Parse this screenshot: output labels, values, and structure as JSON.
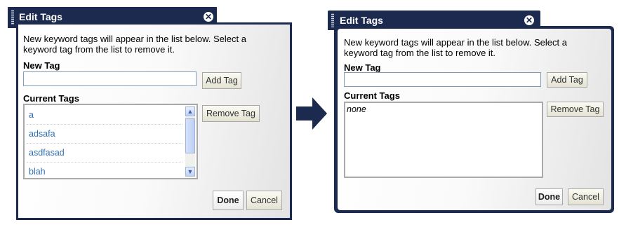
{
  "arrow_icon": "right-arrow-icon",
  "before": {
    "title": "Edit Tags",
    "close_icon": "close-icon",
    "description": "New keyword tags will appear in the list below. Select a keyword tag from the list to remove it.",
    "new_tag_label": "New Tag",
    "new_tag_value": "",
    "add_tag_button": "Add Tag",
    "current_tags_label": "Current Tags",
    "tags": [
      "a",
      "adsafa",
      "asdfasad",
      "blah"
    ],
    "remove_tag_button": "Remove Tag",
    "done_button": "Done",
    "cancel_button": "Cancel"
  },
  "after": {
    "title": "Edit Tags",
    "close_icon": "close-icon",
    "description": "New keyword tags will appear in the list below. Select a keyword tag from the list to remove it.",
    "new_tag_label": "New Tag",
    "new_tag_value": "",
    "add_tag_button": "Add Tag",
    "current_tags_label": "Current Tags",
    "empty_text": "none",
    "remove_tag_button": "Remove Tag",
    "done_button": "Done",
    "cancel_button": "Cancel"
  },
  "colors": {
    "frame": "#1b2a4e",
    "tag_link": "#2f6fb1"
  }
}
